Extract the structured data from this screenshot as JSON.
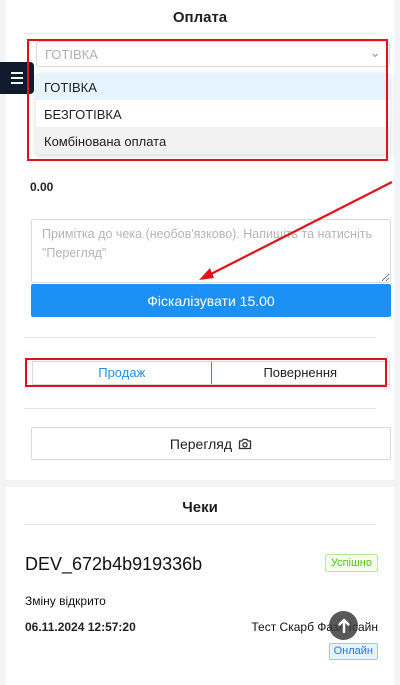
{
  "payment": {
    "title": "Оплата",
    "select_placeholder": "ГОТІВКА",
    "options": [
      "ГОТІВКА",
      "БЕЗГОТІВКА",
      "Комбінована оплата"
    ],
    "amount": "0.00",
    "note_placeholder": "Примітка до чека (необов'язково). Напишіть та натисніть \"Перегляд\"",
    "fiscalize_label": "Фіскалізувати 15.00",
    "tabs": [
      "Продаж",
      "Повернення"
    ],
    "preview_label": "Перегляд"
  },
  "checks": {
    "title": "Чеки",
    "id": "DEV_672b4b919336b",
    "status": "Успішно",
    "shift": "Зміну відкрито",
    "datetime": "06.11.2024 12:57:20",
    "cashier": "Тест Скарб Фазл Ісайн",
    "online": "Онлайн"
  },
  "colors": {
    "accent": "#1d90f5",
    "annotation_red": "#e2121b",
    "sidebar_dark": "#0f1c2e"
  },
  "icons": {
    "menu": "hamburger-icon",
    "preview": "camera-icon",
    "select": "chevron-down-icon",
    "scroll": "arrow-up-icon"
  }
}
